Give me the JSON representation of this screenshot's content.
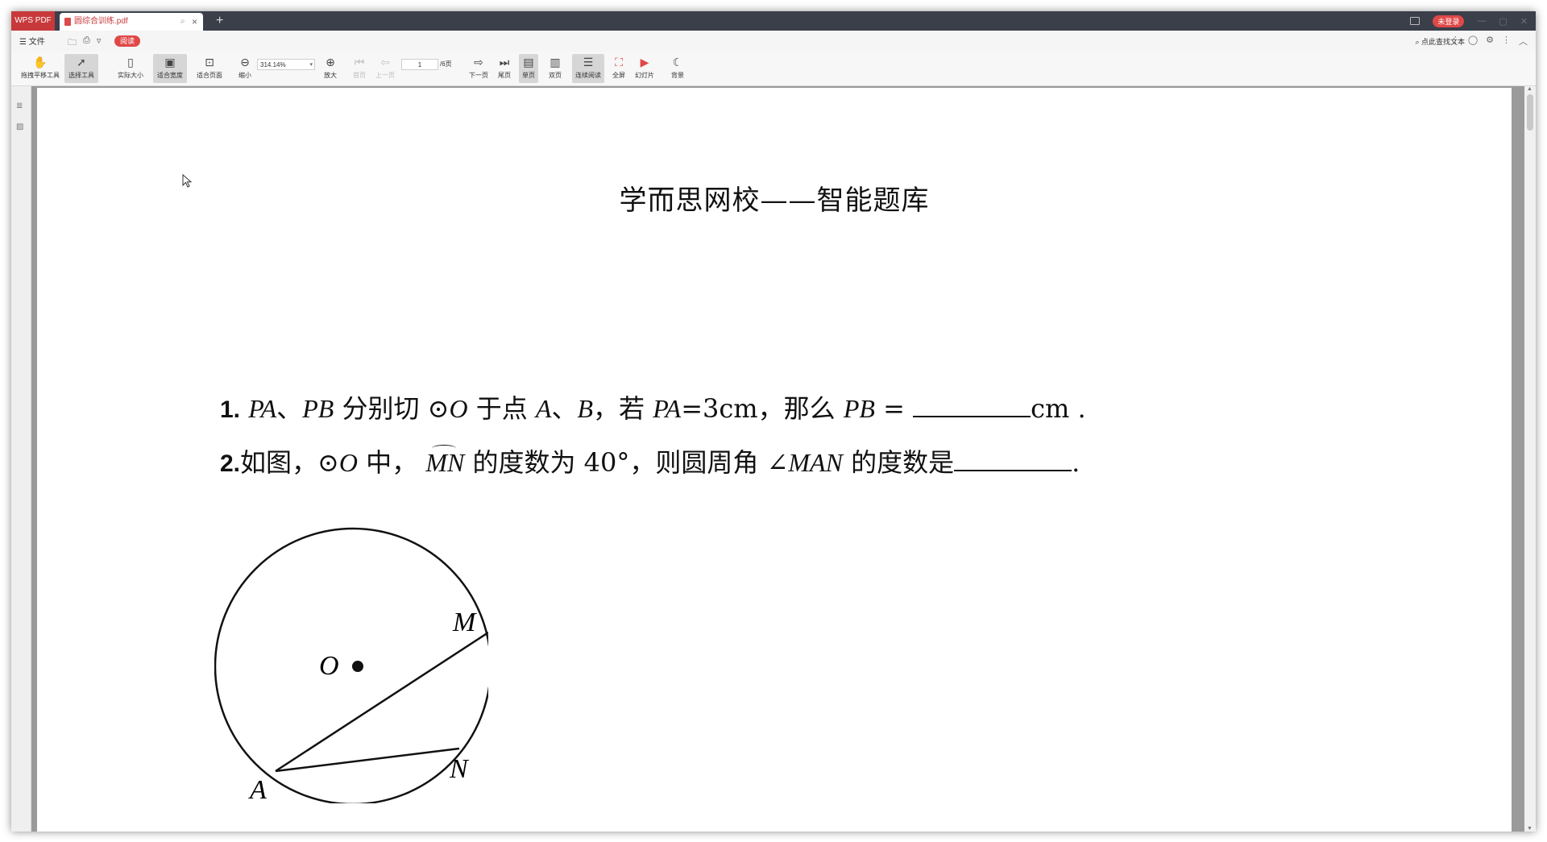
{
  "app": {
    "badge": "WPS PDF"
  },
  "tabs": [
    {
      "label": "圆综合训练.pdf"
    }
  ],
  "titlebar": {
    "new_tab": "+",
    "login": "未登录",
    "minimize": "—",
    "maximize": "▢",
    "close": "✕"
  },
  "menu": {
    "file": "☰ 文件",
    "read": "阅读",
    "find_text": "点此查找文本",
    "more": "⋮"
  },
  "toolbar": {
    "pan": "拖拽平移工具",
    "select": "选择工具",
    "actual_size": "实际大小",
    "fit_width": "适合宽度",
    "fit_page": "适合页面",
    "zoom_out": "缩小",
    "zoom_value": "314.14%",
    "zoom_in": "放大",
    "first_page": "首页",
    "prev_page": "上一页",
    "page_current": "1",
    "page_total": "/6页",
    "next_page": "下一页",
    "last_page": "尾页",
    "single_page": "单页",
    "double_page": "双页",
    "continuous": "连续阅读",
    "fullscreen": "全屏",
    "slideshow": "幻灯片",
    "background": "背景"
  },
  "document": {
    "title": "学而思网校——智能题库",
    "q1": {
      "num": "1.",
      "pa": "PA",
      "sep1": "、",
      "pb": "PB",
      "t1": " 分别切 ",
      "circ": "⊙",
      "o": "O",
      "t2": " 于点 ",
      "a": "A",
      "sep2": "、",
      "b": "B",
      "t3": "，若 ",
      "pa2": "PA",
      "eq": "=3cm，那么 ",
      "pb2": "PB",
      "eq2": " = ",
      "unit": "cm ."
    },
    "q2": {
      "num": "2.",
      "t1": "如图，",
      "circ": "⊙",
      "o": "O",
      "t2": " 中，",
      "arc": "MN",
      "t3": " 的度数为 40°，则圆周角 ∠",
      "man": "MAN",
      "t4": " 的度数是",
      "end": "."
    },
    "diagram_labels": {
      "o": "O",
      "m": "M",
      "n": "N",
      "a": "A"
    }
  }
}
